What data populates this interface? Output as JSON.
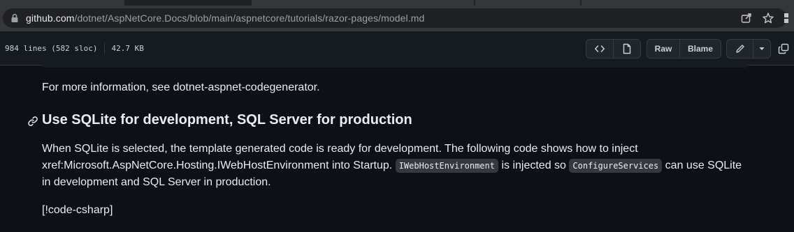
{
  "browser": {
    "url_host": "github.com",
    "url_path": "/dotnet/AspNetCore.Docs/blob/main/aspnetcore/tutorials/razor-pages/model.md"
  },
  "file": {
    "lines": "984 lines (582 sloc)",
    "size": "42.7 KB",
    "raw_label": "Raw",
    "blame_label": "Blame"
  },
  "content": {
    "intro": "For more information, see dotnet-aspnet-codegenerator.",
    "heading": "Use SQLite for development, SQL Server for production",
    "body_line1": "When SQLite is selected, the template generated code is ready for development. The following code shows how to inject",
    "body_line2_a": "xref:Microsoft.AspNetCore.Hosting.IWebHostEnvironment into Startup.",
    "code1": "IWebHostEnvironment",
    "body_line2_b": "is injected so",
    "code2": "ConfigureServices",
    "body_line2_c": "can use SQLite",
    "body_line3": "in development and SQL Server in production.",
    "code_ref": "[!code-csharp]"
  },
  "icons": {
    "lock": "lock-icon",
    "share": "share-icon",
    "star": "star-icon",
    "code": "code-icon",
    "file": "file-icon",
    "pencil": "pencil-icon",
    "dropdown": "triangle-down-icon",
    "copy": "copy-icon",
    "anchor": "link-icon"
  }
}
